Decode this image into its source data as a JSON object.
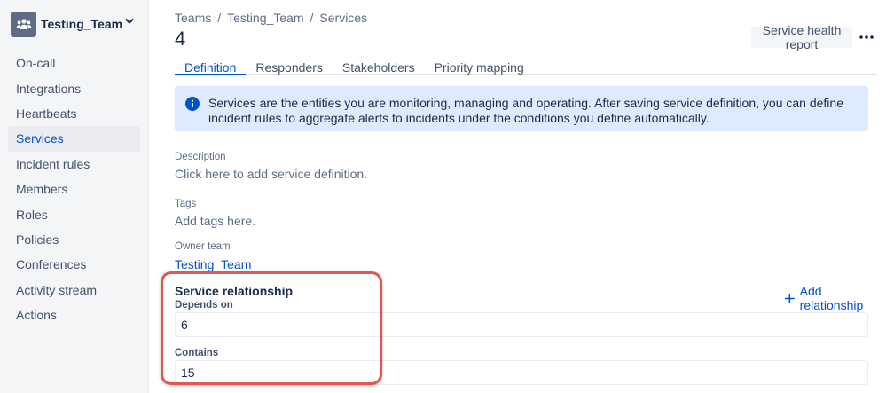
{
  "sidebar": {
    "team_name": "Testing_Team",
    "items": [
      {
        "label": "On-call"
      },
      {
        "label": "Integrations"
      },
      {
        "label": "Heartbeats"
      },
      {
        "label": "Services",
        "active": true
      },
      {
        "label": "Incident rules"
      },
      {
        "label": "Members"
      },
      {
        "label": "Roles"
      },
      {
        "label": "Policies"
      },
      {
        "label": "Conferences"
      },
      {
        "label": "Activity stream"
      },
      {
        "label": "Actions"
      }
    ]
  },
  "breadcrumb": [
    "Teams",
    "Testing_Team",
    "Services"
  ],
  "page": {
    "title": "4",
    "health_report_label": "Service health report"
  },
  "tabs": [
    "Definition",
    "Responders",
    "Stakeholders",
    "Priority mapping"
  ],
  "info": {
    "text": "Services are the entities you are monitoring, managing and operating. After saving service definition, you can define incident rules to aggregate alerts to incidents under the conditions you define automatically."
  },
  "fields": {
    "description_label": "Description",
    "description_value": "Click here to add service definition.",
    "tags_label": "Tags",
    "tags_value": "Add tags here.",
    "owner_label": "Owner team",
    "owner_value": "Testing_Team"
  },
  "relationship": {
    "title": "Service relationship",
    "add_label": "Add relationship",
    "depends_on_label": "Depends on",
    "depends_on_value": "6",
    "contains_label": "Contains",
    "contains_value": "15"
  },
  "colors": {
    "accent": "#0052cc",
    "sidebar_bg": "#f4f5f7",
    "info_bg": "#deebff",
    "highlight": "#e0574f"
  }
}
